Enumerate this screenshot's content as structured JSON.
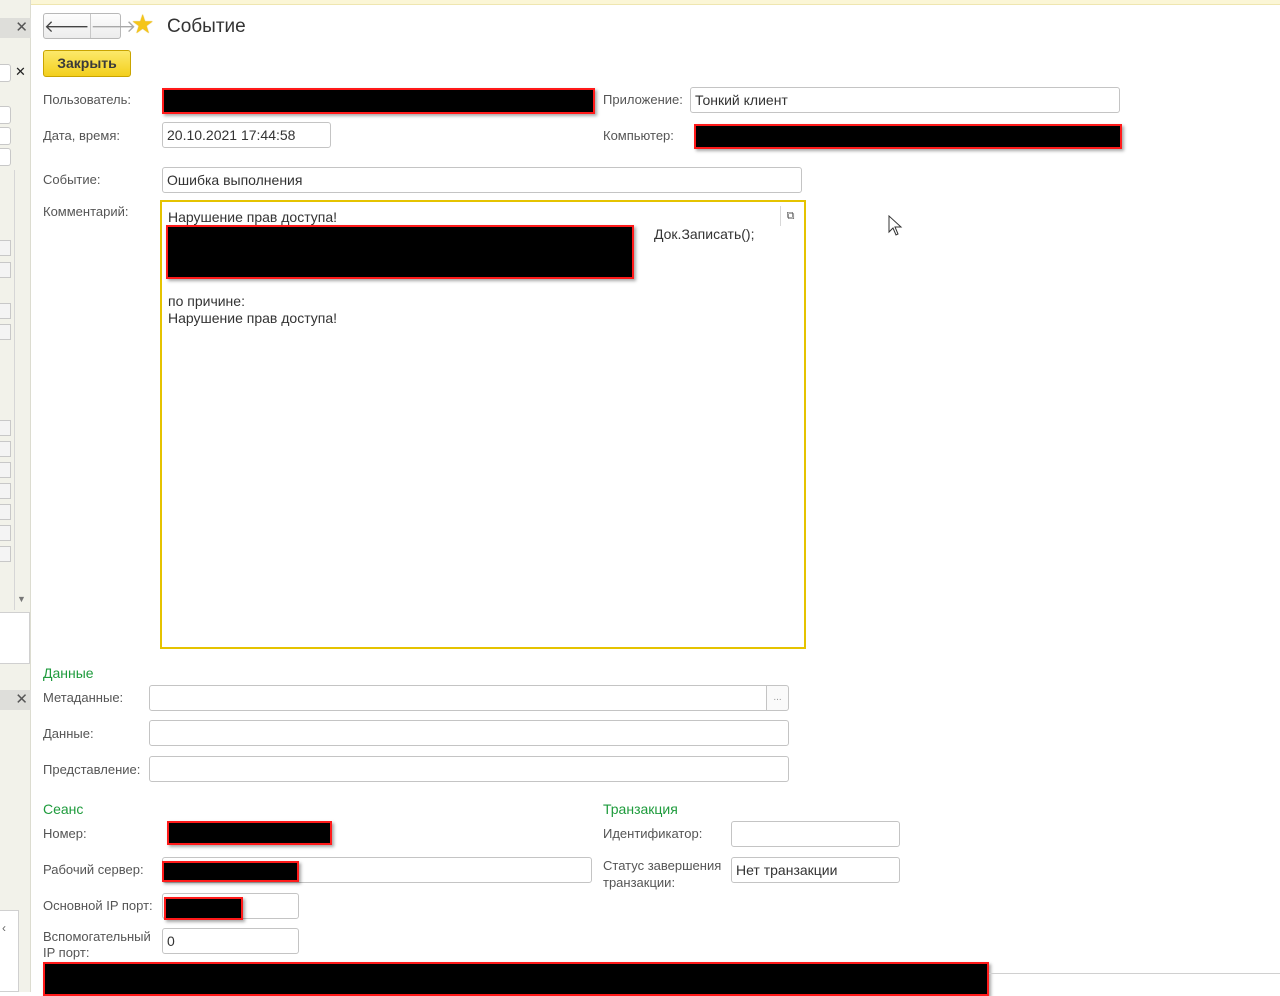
{
  "header": {
    "title": "Событие",
    "back_glyph": "🡐",
    "forward_glyph": "🡒",
    "favorite_glyph": "★",
    "close_label": "Закрыть"
  },
  "form": {
    "user_label": "Пользователь:",
    "application_label": "Приложение:",
    "application_value": "Тонкий клиент",
    "datetime_label": "Дата, время:",
    "datetime_value": "20.10.2021 17:44:58",
    "computer_label": "Компьютер:",
    "event_label": "Событие:",
    "event_value": "Ошибка выполнения",
    "comment_label": "Комментарий:",
    "comment": {
      "line1": "Нарушение прав доступа!",
      "doc_call": "Док.Записать();",
      "reason_label": "по причине:",
      "reason_value": "Нарушение прав доступа!"
    }
  },
  "data_section": {
    "title": "Данные",
    "metadata_label": "Метаданные:",
    "metadata_value": "",
    "data_label": "Данные:",
    "data_value": "",
    "presentation_label": "Представление:",
    "presentation_value": "",
    "ellipsis": "..."
  },
  "session_section": {
    "title": "Сеанс",
    "number_label": "Номер:",
    "server_label": "Рабочий сервер:",
    "main_port_label": "Основной IP порт:",
    "aux_port_label_1": "Вспомогательный",
    "aux_port_label_2": "IP порт:",
    "aux_port_value": "0"
  },
  "transaction_section": {
    "title": "Транзакция",
    "id_label": "Идентификатор:",
    "id_value": "",
    "status_label_1": "Статус завершения",
    "status_label_2": "транзакции:",
    "status_value": "Нет транзакции"
  },
  "icons": {
    "open_icon": "⧉",
    "left_close_glyph": "✕",
    "left_small_glyph": "‹",
    "scroll_arrow": "▼"
  },
  "colors": {
    "accent_yellow": "#f3cf1d",
    "section_green": "#1e9b3c",
    "redaction_border": "#ff1a1a",
    "comment_border": "#e5c300"
  }
}
